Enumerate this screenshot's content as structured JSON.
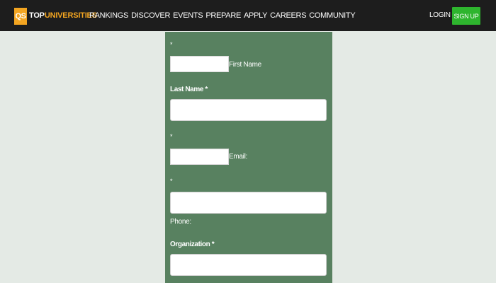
{
  "header": {
    "logo_badge": "QS",
    "logo_top": "TOP",
    "logo_universities": "UNIVERSITIES",
    "nav": [
      "RANKINGS",
      "DISCOVER",
      "EVENTS",
      "PREPARE",
      "APPLY",
      "CAREERS",
      "COMMUNITY"
    ],
    "login_label": "LOGIN",
    "signup_label": "SIGN UP"
  },
  "form": {
    "required_marker": "*",
    "first_name_label": "First Name",
    "first_name_value": "",
    "last_name_label": "Last Name *",
    "last_name_value": "",
    "email_label": "Email:",
    "email_value": "",
    "phone_label": "Phone:",
    "phone_value": "",
    "organization_label": "Organization *",
    "organization_value": ""
  },
  "colors": {
    "header_bg": "#1d1d1d",
    "brand_orange": "#f3a521",
    "signup_green": "#2eb52e",
    "form_bg": "#588160",
    "page_bg": "#e4eae5"
  }
}
